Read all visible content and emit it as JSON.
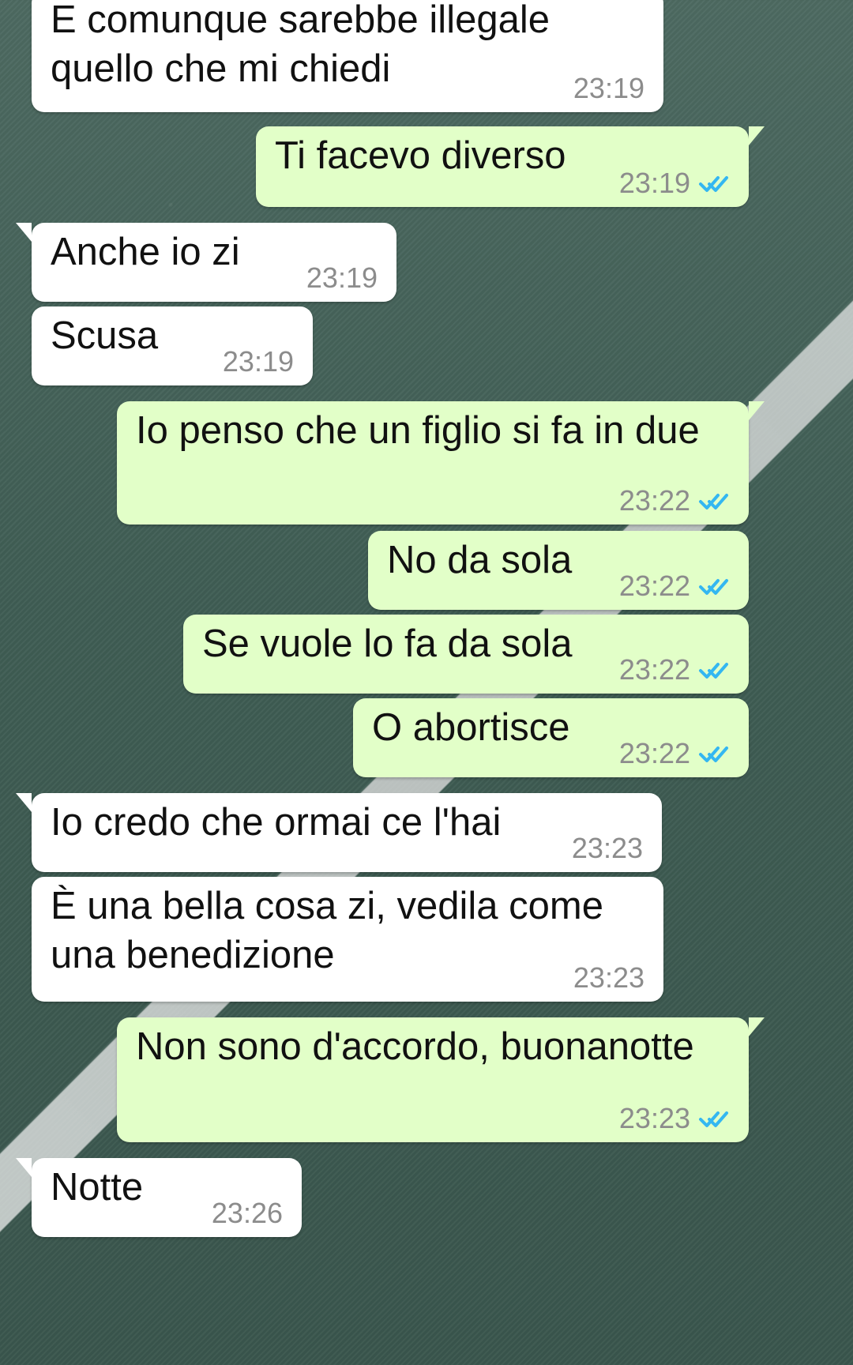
{
  "messages": [
    {
      "text": "E comunque sarebbe illegale\nquello che mi chiedi",
      "time": "23:19"
    },
    {
      "text": "Ti facevo diverso",
      "time": "23:19"
    },
    {
      "text": "Anche io zi",
      "time": "23:19"
    },
    {
      "text": "Scusa",
      "time": "23:19"
    },
    {
      "text": "Io penso che un figlio si fa in due",
      "time": "23:22"
    },
    {
      "text": "No da sola",
      "time": "23:22"
    },
    {
      "text": "Se vuole lo fa da sola",
      "time": "23:22"
    },
    {
      "text": "O abortisce",
      "time": "23:22"
    },
    {
      "text": "Io credo che ormai ce l'hai",
      "time": "23:23"
    },
    {
      "text": "È una bella cosa zi, vedila come\nuna benedizione",
      "time": "23:23"
    },
    {
      "text": "Non sono d'accordo, buonanotte",
      "time": "23:23"
    },
    {
      "text": "Notte",
      "time": "23:26"
    }
  ],
  "icons": {
    "read_receipt": "double-check-icon"
  },
  "colors": {
    "incoming_bubble": "#ffffff",
    "outgoing_bubble": "#e2ffc8",
    "read_receipt": "#34b7f1"
  }
}
